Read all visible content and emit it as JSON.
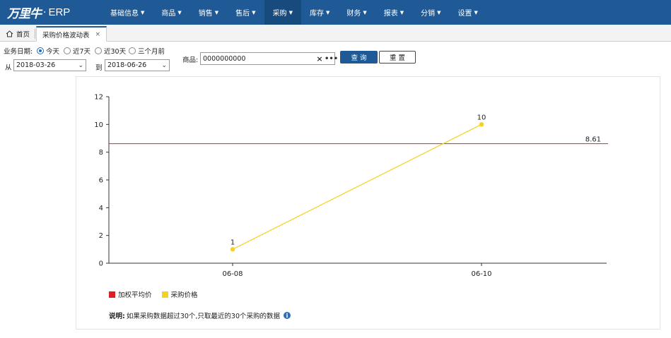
{
  "app": {
    "logo_text": "万里牛",
    "logo_dot": "·",
    "product": "ERP"
  },
  "nav": {
    "items": [
      {
        "label": "基础信息"
      },
      {
        "label": "商品"
      },
      {
        "label": "销售"
      },
      {
        "label": "售后"
      },
      {
        "label": "采购"
      },
      {
        "label": "库存"
      },
      {
        "label": "财务"
      },
      {
        "label": "报表"
      },
      {
        "label": "分销"
      },
      {
        "label": "设置"
      }
    ],
    "active_index": 4
  },
  "tabs": {
    "home_label": "首页",
    "active_label": "采购价格波动表",
    "close_glyph": "×"
  },
  "filter": {
    "date_label": "业务日期:",
    "radios": [
      {
        "label": "今天",
        "checked": true
      },
      {
        "label": "近7天",
        "checked": false
      },
      {
        "label": "近30天",
        "checked": false
      },
      {
        "label": "三个月前",
        "checked": false
      }
    ],
    "from_label": "从",
    "from_value": "2018-03-26",
    "to_label": "到",
    "to_value": "2018-06-26",
    "goods_label": "商品:",
    "goods_value": "0000000000",
    "clear_glyph": "×",
    "more_glyph": "•••",
    "query_label": "查 询",
    "reset_label": "重 置"
  },
  "chart_data": {
    "type": "line",
    "x": [
      "06-08",
      "06-10"
    ],
    "ylim": [
      0,
      12
    ],
    "yticks": [
      0,
      2,
      4,
      6,
      8,
      10,
      12
    ],
    "series": [
      {
        "name": "加权平均价",
        "type": "reference-line",
        "value": 8.61,
        "label": "8.61",
        "color": "#e02020"
      },
      {
        "name": "采购价格",
        "values": [
          1,
          10
        ],
        "labels": [
          "1",
          "10"
        ],
        "color": "#f5d21f"
      }
    ],
    "legend_position": "bottom-left",
    "grid": false
  },
  "legend": [
    {
      "label": "加权平均价",
      "color": "#e02020"
    },
    {
      "label": "采购价格",
      "color": "#f5d21f"
    }
  ],
  "note": {
    "title": "说明:",
    "text": "如果采购数据超过30个,只取最近的30个采购的数据",
    "icon_glyph": "i"
  },
  "colors": {
    "nav_bg": "#1f5a96",
    "nav_active": "#174a7d",
    "button_primary": "#1f5a96"
  }
}
